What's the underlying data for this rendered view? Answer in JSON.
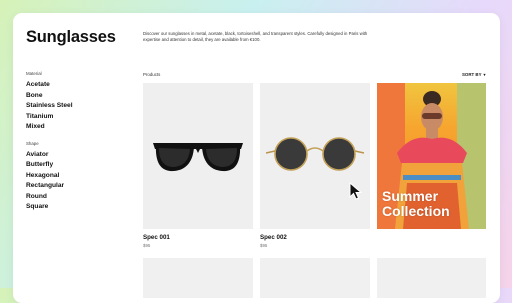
{
  "page": {
    "title": "Sunglasses",
    "description": "Discover our sunglasses in metal, acetate, black, tortoiseshell, and transparent styles. Carefully designed in Paris with expertise and attention to detail, they are available from €100."
  },
  "filters": {
    "material_label": "Material",
    "material": [
      "Acetate",
      "Bone",
      "Stainless Steel",
      "Titanium",
      "Mixed"
    ],
    "shape_label": "Shape",
    "shape": [
      "Aviator",
      "Butterfly",
      "Hexagonal",
      "Rectangular",
      "Round",
      "Square"
    ]
  },
  "products": {
    "label": "Products",
    "sort_label": "SORT BY",
    "items": [
      {
        "name": "Spec 001",
        "price": "$95"
      },
      {
        "name": "Spec 002",
        "price": "$95"
      }
    ]
  },
  "promo": {
    "line1": "Summer",
    "line2": "Collection"
  },
  "icons": {
    "sort_caret": "chevron-down-icon",
    "cursor": "pointer-cursor-icon"
  }
}
